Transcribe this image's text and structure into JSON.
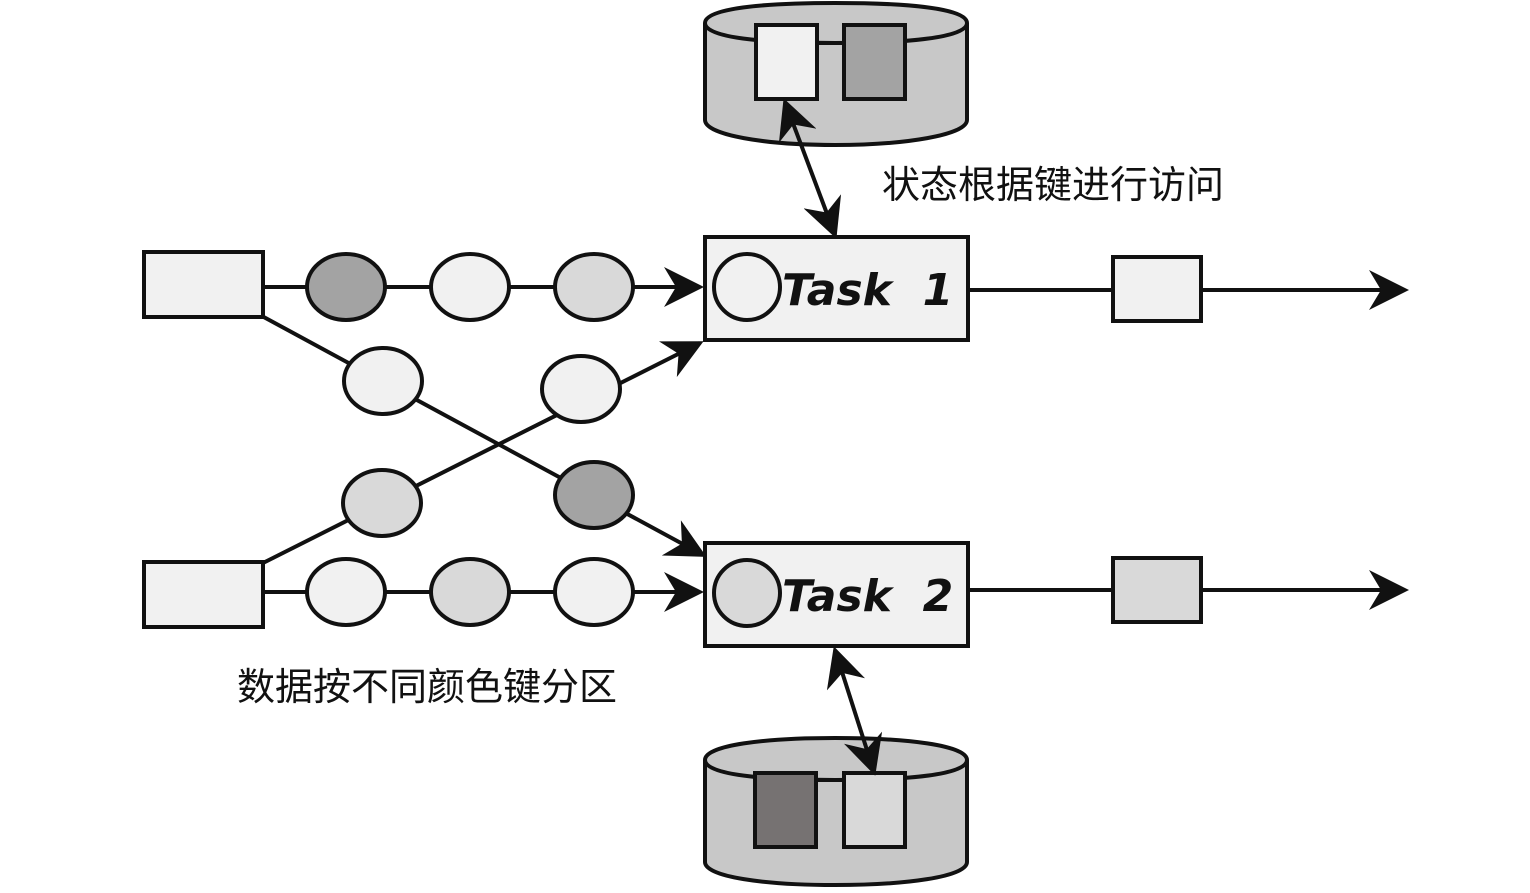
{
  "diagram": {
    "tasks": [
      {
        "label": "Task  1"
      },
      {
        "label": "Task  2"
      }
    ],
    "labels": {
      "state_access": "状态根据键进行访问",
      "partition": "数据按不同颜色键分区"
    },
    "colors": {
      "light": "#f1f1f1",
      "medium": "#d9d9d9",
      "dark": "#a3a3a3",
      "darkest": "#767272",
      "stroke": "#111111",
      "storage": "#c8c8c8"
    }
  }
}
